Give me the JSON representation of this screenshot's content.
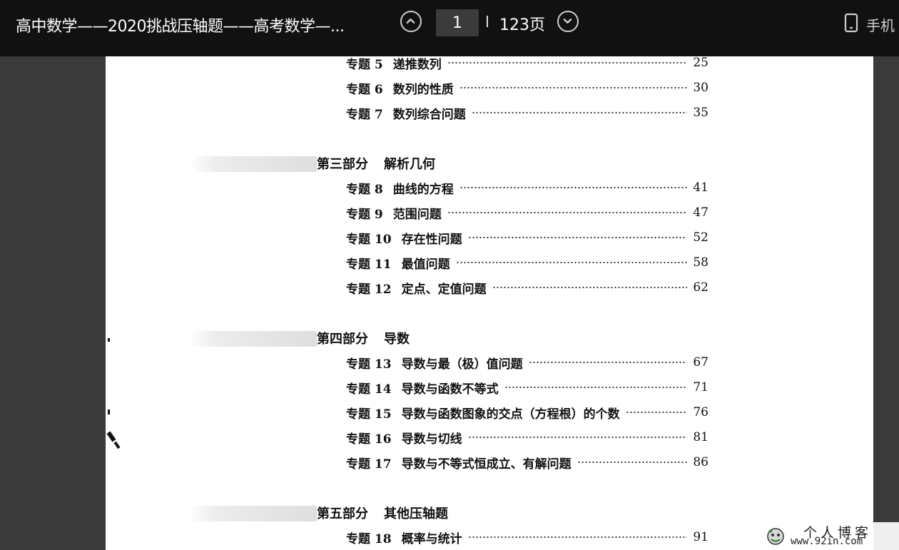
{
  "toolbar": {
    "doc_title": "高中数学——2020挑战压轴题——高考数学—...",
    "prev_icon": "chevron-up-circle-icon",
    "next_icon": "chevron-down-circle-icon",
    "current_page": "1",
    "total_pages": "123页",
    "mobile_icon": "phone-icon",
    "mobile_label": "手机"
  },
  "toc": {
    "sections": [
      {
        "label": "第三部分",
        "title": "解析几何"
      },
      {
        "label": "第四部分",
        "title": "导数"
      },
      {
        "label": "第五部分",
        "title": "其他压轴题"
      }
    ],
    "entries": [
      {
        "label": "专题 5",
        "title": "递推数列",
        "page": "25"
      },
      {
        "label": "专题 6",
        "title": "数列的性质",
        "page": "30"
      },
      {
        "label": "专题 7",
        "title": "数列综合问题",
        "page": "35"
      },
      {
        "label": "专题 8",
        "title": "曲线的方程",
        "page": "41"
      },
      {
        "label": "专题 9",
        "title": "范围问题",
        "page": "47"
      },
      {
        "label": "专题 10",
        "title": "存在性问题",
        "page": "52"
      },
      {
        "label": "专题 11",
        "title": "最值问题",
        "page": "58"
      },
      {
        "label": "专题 12",
        "title": "定点、定值问题",
        "page": "62"
      },
      {
        "label": "专题 13",
        "title": "导数与最（极）值问题",
        "page": "67"
      },
      {
        "label": "专题 14",
        "title": "导数与函数不等式",
        "page": "71"
      },
      {
        "label": "专题 15",
        "title": "导数与函数图象的交点（方程根）的个数",
        "page": "76"
      },
      {
        "label": "专题 16",
        "title": "导数与切线",
        "page": "81"
      },
      {
        "label": "专题 17",
        "title": "导数与不等式恒成立、有解问题",
        "page": "86"
      },
      {
        "label": "专题 18",
        "title": "概率与统计",
        "page": "91"
      }
    ]
  },
  "watermark": {
    "line1": "个人博客",
    "line2": "www.92in.com"
  }
}
